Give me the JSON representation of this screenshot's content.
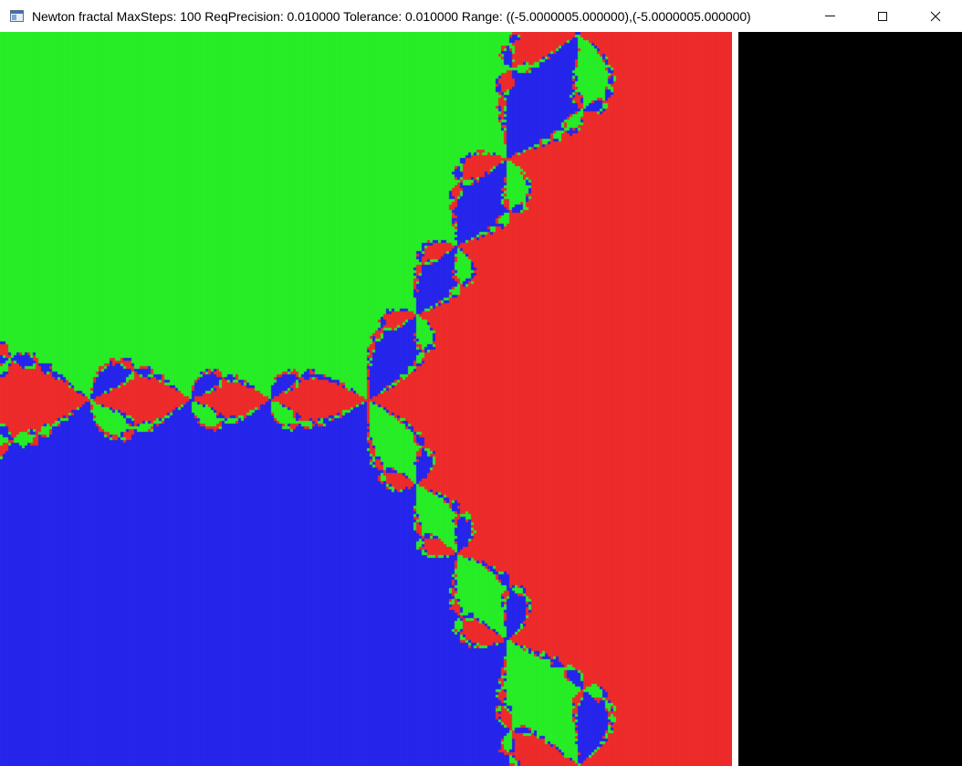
{
  "window": {
    "title": "Newton fractal MaxSteps: 100 ReqPrecision: 0.010000 Tolerance: 0.010000 Range: ((-5.0000005.000000),(-5.0000005.000000)",
    "icons": {
      "app": "window-app-icon",
      "minimize": "minimize-icon",
      "maximize": "maximize-icon",
      "close": "close-icon"
    }
  },
  "fractal": {
    "roots_colors": {
      "root_a": "#2cf22c",
      "root_b": "#f23030",
      "root_c": "#2a2af0"
    },
    "side_panel_color": "#000000"
  }
}
